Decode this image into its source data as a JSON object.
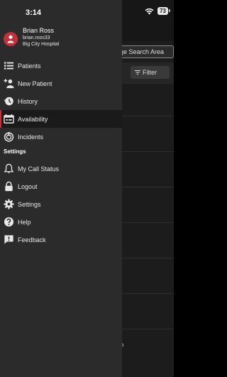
{
  "status_bar": {
    "time": "3:14",
    "battery": "73"
  },
  "user": {
    "name": "Brian Ross",
    "username": "brian.ross33",
    "hospital": "Big City Hospital"
  },
  "menu": [
    {
      "label": "Patients",
      "icon": "list-icon"
    },
    {
      "label": "New Patient",
      "icon": "add-user-icon"
    },
    {
      "label": "History",
      "icon": "history-icon"
    },
    {
      "label": "Availability",
      "icon": "availability-icon",
      "active": true
    },
    {
      "label": "Incidents",
      "icon": "incidents-icon"
    }
  ],
  "settings_section": {
    "title": "Settings",
    "items": [
      {
        "label": "My Call Status",
        "icon": "bell-icon"
      },
      {
        "label": "Logout",
        "icon": "lock-icon"
      },
      {
        "label": "Settings",
        "icon": "gear-icon"
      },
      {
        "label": "Help",
        "icon": "help-icon"
      },
      {
        "label": "Feedback",
        "icon": "feedback-icon"
      }
    ]
  },
  "background": {
    "search_area_label": "ge Search Area",
    "filter_label": "Filter",
    "bottom_fragment": "a"
  },
  "colors": {
    "accent": "#c0313a",
    "drawer_bg": "#2b2b2b",
    "active_bg": "#1a1a1a"
  }
}
